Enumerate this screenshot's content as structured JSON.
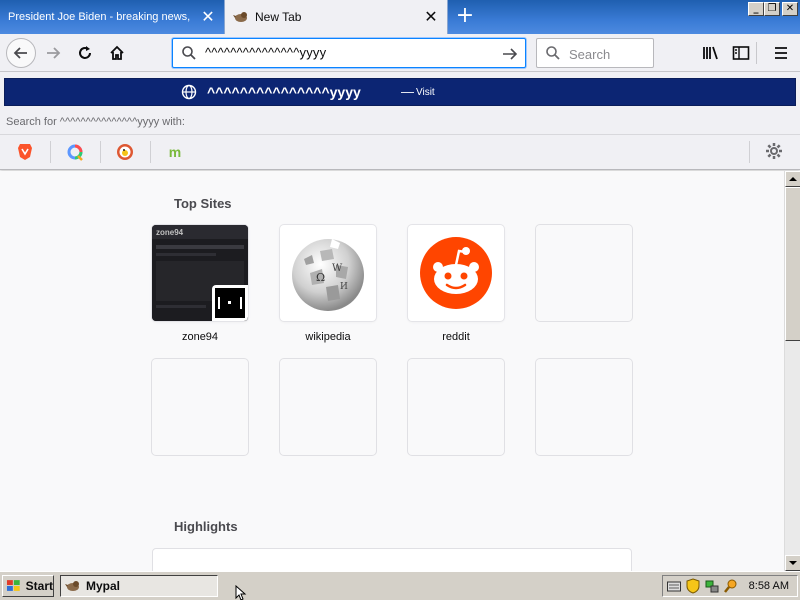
{
  "tabs": [
    {
      "title": "President Joe Biden - breaking news, v",
      "active": false
    },
    {
      "title": "New Tab",
      "active": true
    }
  ],
  "navbar": {
    "url_value": "^^^^^^^^^^^^^^^yyyy",
    "search_placeholder": "Search"
  },
  "dropdown": {
    "suggestion_text": "^^^^^^^^^^^^^^^yyyy",
    "suggestion_dash": "—",
    "suggestion_action": "Visit",
    "search_for_label": "Search for ^^^^^^^^^^^^^^^yyyy with:",
    "engines": [
      "brave",
      "qwant",
      "duckduckgo",
      "mojeek"
    ],
    "engine_mojeek_letter": "m"
  },
  "content": {
    "top_sites_heading": "Top Sites",
    "highlights_heading": "Highlights",
    "top_sites": [
      {
        "label": "zone94",
        "icon": "zone94-thumbnail"
      },
      {
        "label": "wikipedia",
        "icon": "wikipedia-globe"
      },
      {
        "label": "reddit",
        "icon": "reddit-alien"
      }
    ],
    "zone94_thumb_text": "zone94"
  },
  "taskbar": {
    "start_label": "Start",
    "task_label": "Mypal",
    "clock": "8:58 AM"
  },
  "colors": {
    "suggestion_bg": "#0c2573",
    "url_focus": "#0a84ff",
    "reddit": "#ff4500",
    "tab_strip": "#3a7bd5"
  }
}
